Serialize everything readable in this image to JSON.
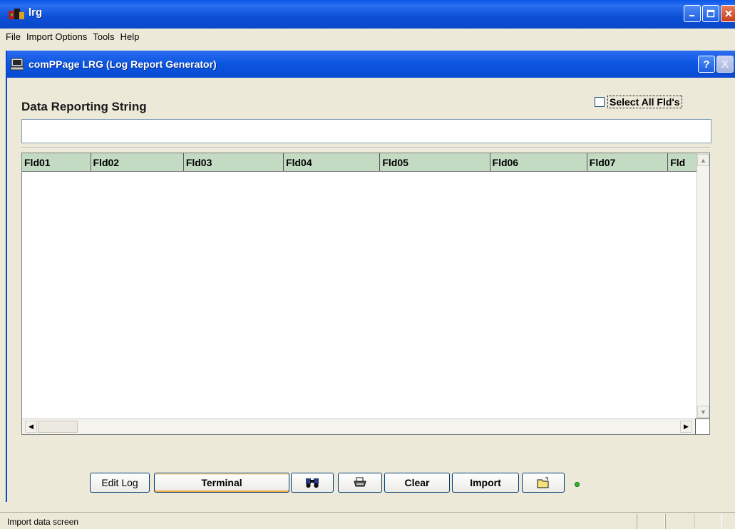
{
  "window": {
    "title": "lrg"
  },
  "menu": [
    "File",
    "Import Options",
    "Tools",
    "Help"
  ],
  "dialog": {
    "title": "comPPage LRG (Log Report Generator)",
    "help_label": "?",
    "close_label": "X"
  },
  "data_reporting": {
    "label": "Data Reporting String",
    "value": "",
    "select_all_label": "Select All Fld's",
    "select_all_checked": false
  },
  "grid": {
    "columns": [
      "Fld01",
      "Fld02",
      "Fld03",
      "Fld04",
      "Fld05",
      "Fld06",
      "Fld07",
      "Fld"
    ],
    "rows": []
  },
  "buttons": {
    "edit_log": "Edit Log",
    "terminal": "Terminal",
    "clear": "Clear",
    "import": "Import"
  },
  "icons": {
    "find": "binoculars-icon",
    "print": "printer-icon",
    "open": "folder-open-icon"
  },
  "status": {
    "text": "Import data screen",
    "indicator_color": "#2eb82e"
  }
}
